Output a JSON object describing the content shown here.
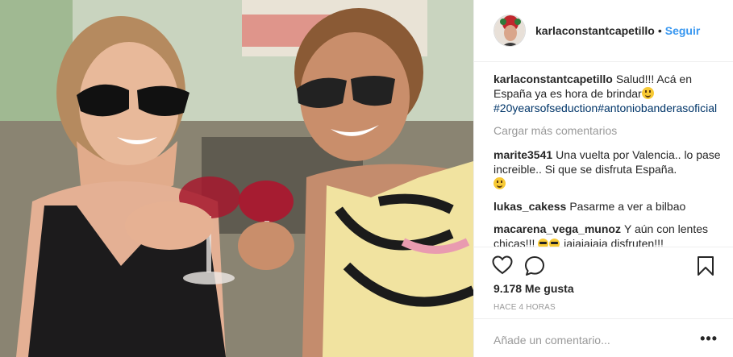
{
  "header": {
    "username": "karlaconstantcapetillo",
    "separator": "•",
    "follow_label": "Seguir"
  },
  "caption": {
    "username": "karlaconstantcapetillo",
    "text_before_emoji": "Salud!!! Acá en España ya es hora de brindar",
    "hashtag_1": "#20yearsofseduction",
    "hashtag_2": "#antoniobanderasoficial"
  },
  "load_more": "Cargar más comentarios",
  "comments": [
    {
      "username": "marite3541",
      "text": "Una vuelta por Valencia.. lo pase increible.. Si que se disfruta España."
    },
    {
      "username": "lukas_cakess",
      "text": "Pasarme a ver a bilbao"
    },
    {
      "username": "macarena_vega_munoz",
      "text": "Y aún con lentes chicas!!!",
      "text_after_emoji": "jajajajaja disfruten!!!"
    }
  ],
  "likes": "9.178 Me gusta",
  "timestamp": "HACE 4 HORAS",
  "add_comment": {
    "placeholder": "Añade un comentario..."
  },
  "more_options": "•••",
  "icons": [
    "heart-icon",
    "comment-icon",
    "bookmark-icon",
    "sunglasses-emoji-icon",
    "smile-emoji-icon",
    "more-options-icon"
  ],
  "colors": {
    "follow": "#3897f0",
    "hashtag": "#003569",
    "muted": "#999999",
    "divider": "#efefef"
  }
}
